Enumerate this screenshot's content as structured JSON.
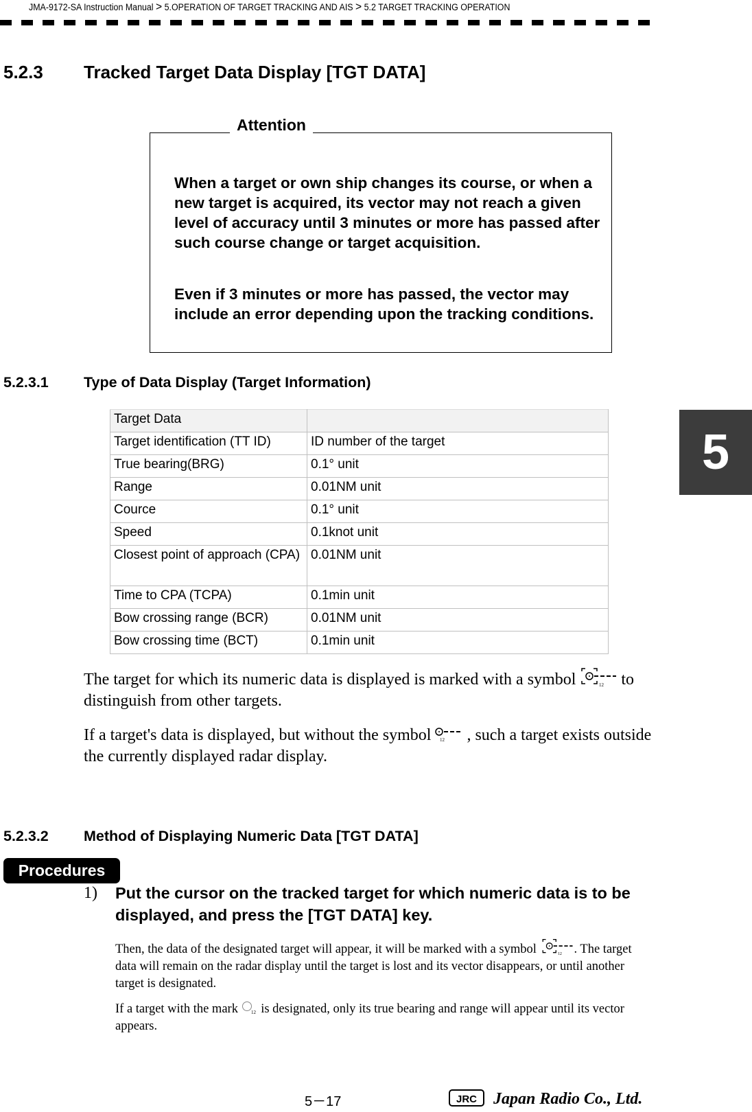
{
  "header": {
    "breadcrumb": [
      "JMA-9172-SA Instruction Manual",
      ">",
      "5.OPERATION OF TARGET TRACKING AND AIS",
      ">",
      "5.2  TARGET TRACKING OPERATION"
    ]
  },
  "section": {
    "number": "5.2.3",
    "title": "Tracked Target Data Display [TGT DATA]"
  },
  "attention": {
    "label": "Attention",
    "paragraphs": [
      "When a target or own ship changes its course, or when a new target is acquired, its vector may not reach a given level of accuracy until 3 minutes or more has passed after such course change or target acquisition.",
      "Even if 3 minutes or more has passed, the vector may include an error depending upon the tracking conditions."
    ]
  },
  "sub1": {
    "number": "5.2.3.1",
    "title": "Type of Data Display (Target Information)"
  },
  "table": {
    "header": [
      "Target Data",
      ""
    ],
    "rows": [
      [
        "Target identification (TT ID)",
        "ID number of the target"
      ],
      [
        "True bearing(BRG)",
        "0.1° unit"
      ],
      [
        "Range",
        "0.01NM unit"
      ],
      [
        "Cource",
        "0.1° unit"
      ],
      [
        "Speed",
        "0.1knot unit"
      ],
      [
        "Closest point of approach (CPA)",
        "0.01NM unit"
      ],
      [
        "Time to CPA (TCPA)",
        "0.1min unit"
      ],
      [
        "Bow crossing range (BCR)",
        "0.01NM unit"
      ],
      [
        "Bow crossing time (BCT)",
        "0.1min unit"
      ]
    ]
  },
  "para1": {
    "before": "The target for which its numeric data is displayed is marked with a symbol ",
    "after": " to distinguish from other targets."
  },
  "para2": {
    "before": "If a target's data is displayed, but without the symbol ",
    "after": " , such a target exists outside the currently displayed radar display."
  },
  "symbol_number": "12",
  "sub2": {
    "number": "5.2.3.2",
    "title": "Method of Displaying Numeric Data [TGT DATA]"
  },
  "procedures": {
    "label": "Procedures",
    "step_number": "1)",
    "step_text": "Put the cursor on the tracked target for which numeric data is to be displayed, and press the [TGT DATA] key.",
    "detail1_before": "Then, the data of the designated target will appear, it will be marked with a symbol ",
    "detail1_after": ". The target data will remain on the radar display until the target is lost and its vector disappears, or until another target is designated.",
    "detail2_before": "If a target with the mark ",
    "detail2_after": " is designated, only its true bearing and range will appear until its vector appears."
  },
  "chapter_tab": "5",
  "footer": {
    "page": "5－17",
    "logo_text": "JRC Japan Radio Co., Ltd."
  }
}
